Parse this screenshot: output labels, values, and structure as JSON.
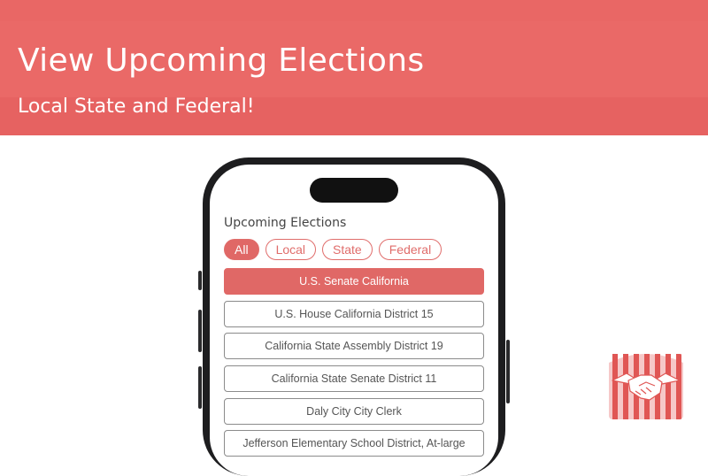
{
  "banner": {
    "title": "View Upcoming Elections",
    "subtitle": "Local State and Federal!"
  },
  "app": {
    "title": "Upcoming Elections",
    "filters": [
      {
        "label": "All",
        "active": true
      },
      {
        "label": "Local",
        "active": false
      },
      {
        "label": "State",
        "active": false
      },
      {
        "label": "Federal",
        "active": false
      }
    ],
    "elections": [
      {
        "label": "U.S. Senate California",
        "selected": true
      },
      {
        "label": "U.S. House California District 15",
        "selected": false
      },
      {
        "label": "California State Assembly District 19",
        "selected": false
      },
      {
        "label": "California State Senate District 11",
        "selected": false
      },
      {
        "label": "Daly City City Clerk",
        "selected": false
      },
      {
        "label": "Jefferson Elementary School District, At-large",
        "selected": false
      }
    ]
  },
  "logo": {
    "icon": "handshake-icon",
    "colors": {
      "stripe": "#e05654",
      "bg": "#f6c8c8",
      "hands": "#ffffff"
    }
  },
  "colors": {
    "banner": "#ea6967",
    "accent": "#e06866",
    "phone_frame": "#1d1d1f"
  }
}
